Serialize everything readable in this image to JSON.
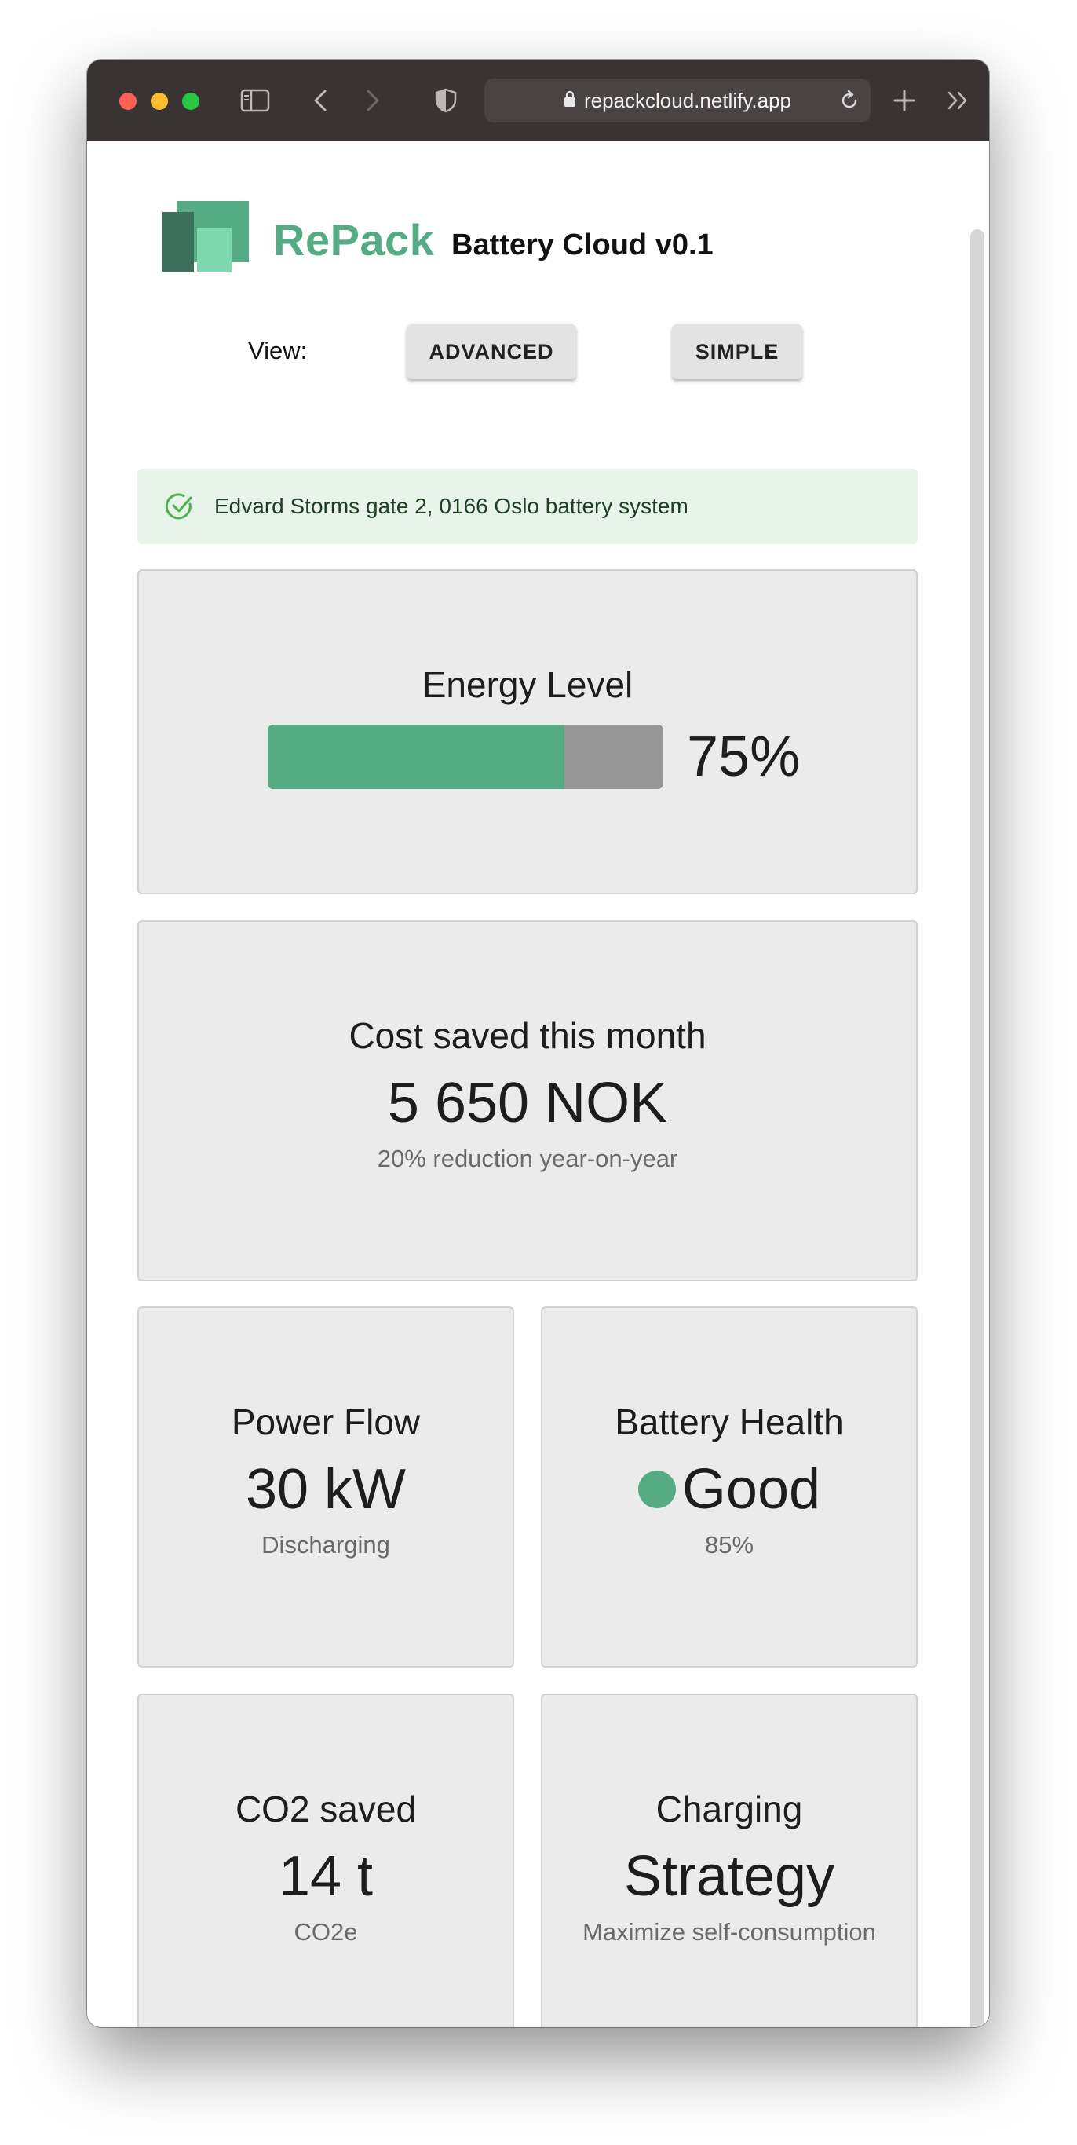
{
  "browser": {
    "url": "repackcloud.netlify.app"
  },
  "header": {
    "brand": "RePack",
    "title": "Battery Cloud v0.1",
    "view_label": "View:",
    "advanced_label": "ADVANCED",
    "simple_label": "SIMPLE"
  },
  "alert": {
    "text": "Edvard Storms gate 2, 0166 Oslo battery system"
  },
  "energy": {
    "title": "Energy Level",
    "level_percent": 75,
    "label": "75%"
  },
  "cost": {
    "title": "Cost saved this month",
    "value": "5 650 NOK",
    "sub": "20% reduction year-on-year"
  },
  "power": {
    "title": "Power Flow",
    "value": "30 kW",
    "sub": "Discharging"
  },
  "health": {
    "title": "Battery Health",
    "value": "Good",
    "sub": "85%"
  },
  "co2": {
    "title": "CO2 saved",
    "value": "14 t",
    "sub": "CO2e"
  },
  "charging": {
    "title": "Charging",
    "value": "Strategy",
    "sub": "Maximize self-consumption"
  },
  "colors": {
    "accent": "#55ab84",
    "bar_empty": "#969696",
    "card_bg": "#ebebeb",
    "alert_bg": "#e8f3e9"
  },
  "icons": [
    "sidebar-icon",
    "back-icon",
    "forward-icon",
    "shield-icon",
    "lock-icon",
    "reload-icon",
    "new-tab-icon",
    "overflow-icon",
    "check-circle-icon"
  ]
}
